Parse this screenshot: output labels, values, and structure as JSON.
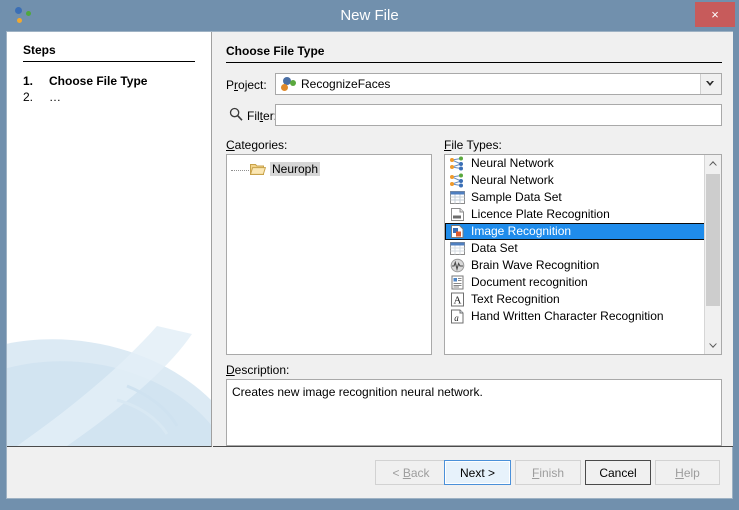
{
  "window": {
    "title": "New File",
    "app_icon": "netbeans-logo-icon",
    "close_label": "×"
  },
  "steps": {
    "heading": "Steps",
    "items": [
      {
        "num": "1.",
        "label": "Choose File Type",
        "current": true
      },
      {
        "num": "2.",
        "label": "…",
        "current": false
      }
    ]
  },
  "content": {
    "title": "Choose File Type",
    "project": {
      "label_pre": "P",
      "label_mn": "r",
      "label_post": "oject:",
      "value": "RecognizeFaces",
      "icon": "netbeans-project-icon"
    },
    "filter": {
      "label_pre": "Fil",
      "label_mn": "t",
      "label_post": "er:",
      "value": "",
      "placeholder": "",
      "icon": "search-icon"
    },
    "categories": {
      "label_pre": "",
      "label_mn": "C",
      "label_post": "ategories:",
      "items": [
        {
          "label": "Neuroph",
          "icon": "folder-icon",
          "selected": true
        }
      ]
    },
    "file_types": {
      "label_pre": "",
      "label_mn": "F",
      "label_post": "ile Types:",
      "items": [
        {
          "label": "Neural Network",
          "icon": "neural-network-icon",
          "selected": false
        },
        {
          "label": "Neural Network",
          "icon": "neural-network-icon",
          "selected": false
        },
        {
          "label": "Sample Data Set",
          "icon": "data-grid-icon",
          "selected": false
        },
        {
          "label": "Licence Plate Recognition",
          "icon": "plate-icon",
          "selected": false
        },
        {
          "label": "Image Recognition",
          "icon": "image-icon",
          "selected": true
        },
        {
          "label": "Data Set",
          "icon": "data-grid-icon",
          "selected": false
        },
        {
          "label": "Brain Wave Recognition",
          "icon": "brain-wave-icon",
          "selected": false
        },
        {
          "label": "Document recognition",
          "icon": "document-icon",
          "selected": false
        },
        {
          "label": "Text Recognition",
          "icon": "text-a-icon",
          "selected": false
        },
        {
          "label": "Hand Written Character Recognition",
          "icon": "handwriting-icon",
          "selected": false
        }
      ]
    },
    "description": {
      "label_pre": "",
      "label_mn": "D",
      "label_post": "escription:",
      "text": "Creates new image recognition neural network."
    }
  },
  "buttons": [
    {
      "name": "back-button",
      "pre": "< ",
      "mn": "B",
      "post": "ack",
      "state": "disabled"
    },
    {
      "name": "next-button",
      "pre": "",
      "mn": "N",
      "post": "ext >",
      "state": "focused"
    },
    {
      "name": "finish-button",
      "pre": "",
      "mn": "F",
      "post": "inish",
      "state": "disabled"
    },
    {
      "name": "cancel-button",
      "pre": "Cancel",
      "mn": "",
      "post": "",
      "state": "default"
    },
    {
      "name": "help-button",
      "pre": "",
      "mn": "H",
      "post": "elp",
      "state": "disabled"
    }
  ],
  "colors": {
    "titlebar": "#7190ad",
    "close": "#c75b5b",
    "selection": "#1f8ceb",
    "dialog_bg": "#f0f0f0",
    "tree_selection": "#d6d6d6"
  }
}
